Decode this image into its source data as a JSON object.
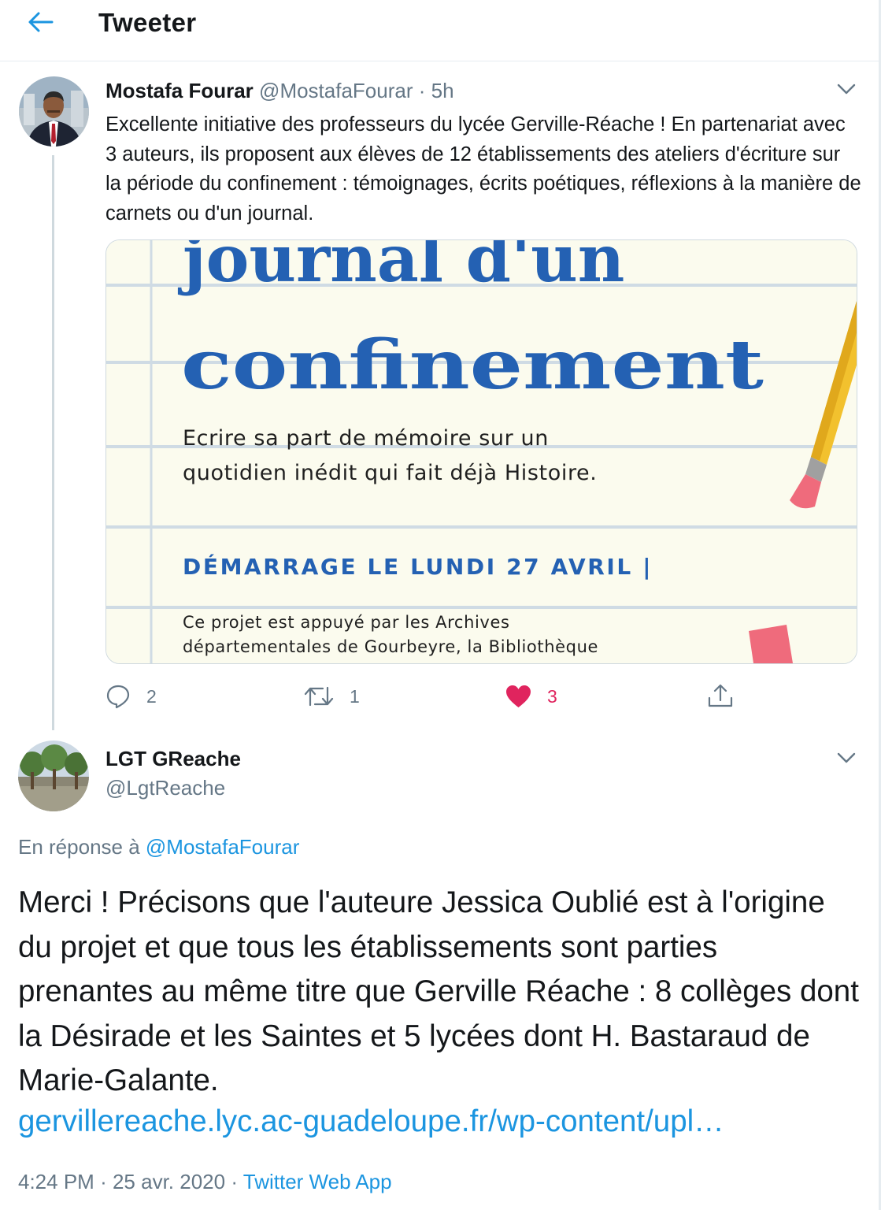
{
  "colors": {
    "link": "#1b95e0",
    "muted": "#657786",
    "like": "#e0245e",
    "image_blue": "#2461b3"
  },
  "header": {
    "title": "Tweeter",
    "back_icon": "arrow-left-icon"
  },
  "tweet1": {
    "author_name": "Mostafa Fourar",
    "handle": "@MostafaFourar",
    "separator": "·",
    "age": "5h",
    "text": "Excellente initiative des professeurs du lycée Gerville-Réache ! En partenariat avec 3 auteurs, ils proposent aux élèves de 12 établissements des ateliers d'écriture sur la période du confinement : témoignages, écrits poétiques, réflexions à la manière de carnets ou d'un journal.",
    "media": {
      "line1": "journal d'un",
      "line2": "confinement",
      "subtitle1": "Ecrire sa part de mémoire sur un",
      "subtitle2": "quotidien inédit qui fait déjà Histoire.",
      "start": "DÉMARRAGE LE LUNDI 27 AVRIL |",
      "footer1": "Ce projet est appuyé par les Archives",
      "footer2": "départementales de Gourbeyre, la Bibliothèque"
    },
    "actions": {
      "replies": "2",
      "retweets": "1",
      "likes": "3",
      "liked": true
    }
  },
  "tweet2": {
    "author_name": "LGT GReache",
    "handle": "@LgtReache",
    "reply_prefix": "En réponse à",
    "reply_to": "@MostafaFourar",
    "text": "Merci ! Précisons que l'auteure Jessica Oublié est à l'origine du projet et que tous les établissements sont parties prenantes au même titre que Gerville Réache : 8 collèges dont la Désirade et les Saintes et 5 lycées dont H. Bastaraud de Marie-Galante.",
    "link": "gervillereache.lyc.ac-guadeloupe.fr/wp-content/upl…",
    "time": "4:24 PM",
    "dot": "·",
    "date": "25 avr. 2020",
    "dot2": "·",
    "source": "Twitter Web App"
  }
}
